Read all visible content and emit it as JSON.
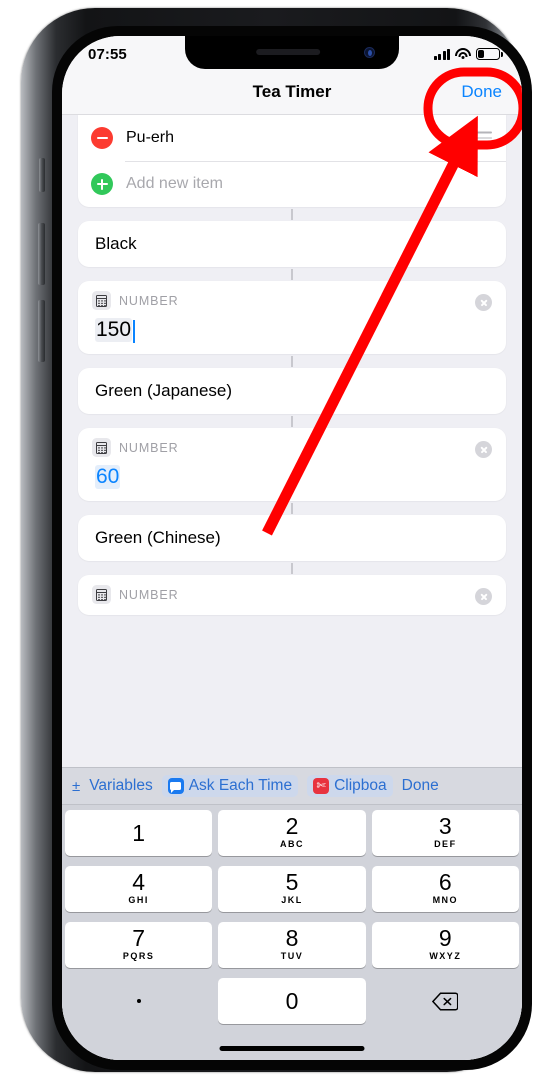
{
  "status_bar": {
    "time": "07:55",
    "signal_icon": "cellular-bars-icon",
    "wifi_icon": "wifi-icon",
    "battery_icon": "battery-icon",
    "battery_level_percent": 26
  },
  "nav_bar": {
    "title": "Tea Timer",
    "done_label": "Done",
    "done_color": "#0a84ff"
  },
  "list_card": {
    "rows": [
      {
        "label": "Pu-erh",
        "icon": "minus-circle-icon",
        "placeholder": false,
        "drag_handle": "reorder-handle-icon"
      },
      {
        "label": "Add new item",
        "icon": "plus-circle-icon",
        "placeholder": true
      }
    ]
  },
  "cards": [
    {
      "type": "text",
      "label": "Black"
    },
    {
      "type": "number",
      "field_label": "NUMBER",
      "value": "150",
      "icon": "calculator-icon",
      "clear_icon": "clear-circle-icon",
      "highlighted": false,
      "caret": true
    },
    {
      "type": "text",
      "label": "Green (Japanese)"
    },
    {
      "type": "number",
      "field_label": "NUMBER",
      "value": "60",
      "icon": "calculator-icon",
      "clear_icon": "clear-circle-icon",
      "highlighted": true,
      "caret": false
    },
    {
      "type": "text",
      "label": "Green (Chinese)"
    },
    {
      "type": "number",
      "field_label": "NUMBER",
      "value": "",
      "icon": "calculator-icon",
      "clear_icon": "clear-circle-icon",
      "highlighted": false,
      "caret": false
    }
  ],
  "keyboard": {
    "toolbar": {
      "plus_minus": "±",
      "variables_label": "Variables",
      "ask_each_time_label": "Ask Each Time",
      "ask_each_time_icon": "speech-bubble-icon",
      "clipboard_label": "Clipboa",
      "clipboard_icon": "scissors-icon",
      "done_label": "Done"
    },
    "keys": [
      [
        {
          "digit": "1",
          "letters": ""
        },
        {
          "digit": "2",
          "letters": "ABC"
        },
        {
          "digit": "3",
          "letters": "DEF"
        }
      ],
      [
        {
          "digit": "4",
          "letters": "GHI"
        },
        {
          "digit": "5",
          "letters": "JKL"
        },
        {
          "digit": "6",
          "letters": "MNO"
        }
      ],
      [
        {
          "digit": "7",
          "letters": "PQRS"
        },
        {
          "digit": "8",
          "letters": "TUV"
        },
        {
          "digit": "9",
          "letters": "WXYZ"
        }
      ]
    ],
    "bottom_row": {
      "period": ".",
      "zero": "0",
      "backspace_icon": "backspace-delete-icon"
    }
  },
  "annotations": {
    "highlight_color": "#ff0000",
    "circle_target": "Done",
    "arrow_from": "Green (Japanese) number field",
    "arrow_to": "Done button"
  }
}
